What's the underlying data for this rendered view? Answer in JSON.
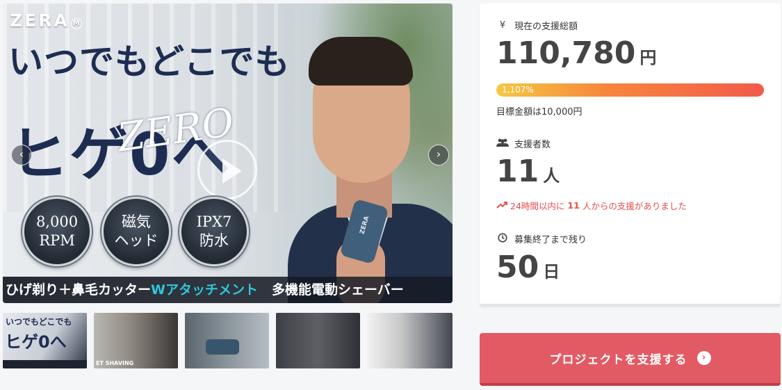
{
  "hero": {
    "brand": "ZERA",
    "brand_mark": "M",
    "headline_1": "いつでもどこでも",
    "headline_2": "ヒゲ0へ",
    "headline_word": "ZERO",
    "badges": [
      {
        "line1": "8,000",
        "line2": "RPM"
      },
      {
        "line1": "磁気",
        "line2": "ヘッド"
      },
      {
        "line1": "IPX7",
        "line2": "防水"
      }
    ],
    "band_text_1": "ひげ剃り＋鼻毛カッター",
    "band_text_w": "Wアタッチメント",
    "band_text_2": "多機能電動シェーバー",
    "device_label": "ZERA",
    "prev_icon": "‹",
    "next_icon": "›"
  },
  "thumbnails": [
    {
      "caption_1": "いつでもどこでも",
      "caption_2": "ヒゲ0へ"
    },
    {
      "caption": "ET SHAVING"
    },
    {},
    {},
    {}
  ],
  "stats": {
    "total_label": "現在の支援総額",
    "total_icon": "¥",
    "total_amount": "110,780",
    "total_unit": "円",
    "progress_text": "1,107%",
    "progress_fraction": 1.0,
    "goal_text": "目標金額は10,000円",
    "backers_label": "支援者数",
    "backers_icon": "people-icon",
    "backers_count": "11",
    "backers_unit": "人",
    "trend_pre": "24時間以内に",
    "trend_count": "11",
    "trend_post": "人からの支援がありました",
    "remaining_label": "募集終了まで残り",
    "remaining_icon": "clock-icon",
    "remaining_count": "50",
    "remaining_unit": "日"
  },
  "cta": {
    "label": "プロジェクトを支援する",
    "icon": "›"
  },
  "colors": {
    "accent": "#e25a63",
    "headline": "#1d2d52",
    "trend": "#e84d4d"
  }
}
